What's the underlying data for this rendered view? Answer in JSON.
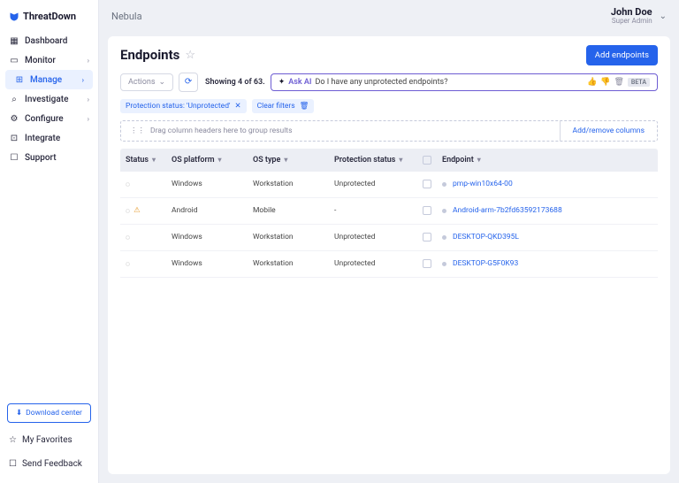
{
  "brand": "ThreatDown",
  "workspace": "Nebula",
  "user": {
    "name": "John Doe",
    "role": "Super Admin"
  },
  "nav": {
    "dashboard": "Dashboard",
    "monitor": "Monitor",
    "manage": "Manage",
    "investigate": "Investigate",
    "configure": "Configure",
    "integrate": "Integrate",
    "support": "Support",
    "download": "Download center",
    "favorites": "My Favorites",
    "feedback": "Send Feedback"
  },
  "page": {
    "title": "Endpoints",
    "addBtn": "Add endpoints"
  },
  "toolbar": {
    "actions": "Actions",
    "count": "Showing 4 of 63."
  },
  "ask": {
    "label": "Ask AI",
    "query": "Do I have any unprotected endpoints?",
    "beta": "BETA"
  },
  "filterChip": {
    "label": "Protection status: 'Unprotected'"
  },
  "clearFilters": "Clear filters",
  "groupHint": "Drag column headers here to group results",
  "addRemoveCols": "Add/remove columns",
  "cols": {
    "status": "Status",
    "os": "OS platform",
    "type": "OS type",
    "prot": "Protection status",
    "ep": "Endpoint"
  },
  "rows": [
    {
      "os": "Windows",
      "type": "Workstation",
      "prot": "Unprotected",
      "ep": "pmp-win10x64-00",
      "warn": false
    },
    {
      "os": "Android",
      "type": "Mobile",
      "prot": "-",
      "ep": "Android-arm-7b2fd63592173688",
      "warn": true
    },
    {
      "os": "Windows",
      "type": "Workstation",
      "prot": "Unprotected",
      "ep": "DESKTOP-QKD395L",
      "warn": false
    },
    {
      "os": "Windows",
      "type": "Workstation",
      "prot": "Unprotected",
      "ep": "DESKTOP-G5F0K93",
      "warn": false
    }
  ]
}
